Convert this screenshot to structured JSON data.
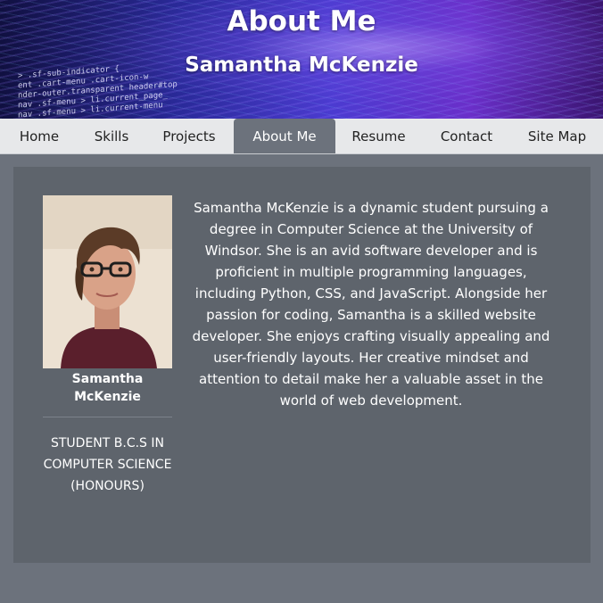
{
  "header": {
    "title": "About Me",
    "subtitle": "Samantha McKenzie",
    "code_lines": [
      ">  .sf-sub-indicator {",
      "ent .cart-menu .cart-icon-w",
      "nder-outer.transparent header#top",
      "nav .sf-menu > li.current_page_",
      "nav .sf-menu > li.current-menu"
    ]
  },
  "nav": {
    "items": [
      {
        "label": "Home"
      },
      {
        "label": "Skills"
      },
      {
        "label": "Projects"
      },
      {
        "label": "About Me",
        "active": true
      },
      {
        "label": "Resume"
      },
      {
        "label": "Contact"
      },
      {
        "label": "Site Map"
      }
    ]
  },
  "profile": {
    "name": "Samantha McKenzie",
    "degree": "STUDENT B.C.S IN COMPUTER SCIENCE (HONOURS)"
  },
  "bio": "Samantha McKenzie is a dynamic student pursuing a degree in Computer Science at the University of Windsor. She is an avid software developer and is proficient in multiple programming languages, including Python, CSS, and JavaScript. Alongside her passion for coding, Samantha is a skilled website developer. She enjoys crafting visually appealing and user-friendly layouts. Her creative mindset and attention to detail make her a valuable asset in the world of web development.",
  "colors": {
    "page_bg": "#6c727c",
    "panel_bg": "#5e646c",
    "nav_bg": "#e7e8ea",
    "banner_accent": "#4b3bd0"
  }
}
